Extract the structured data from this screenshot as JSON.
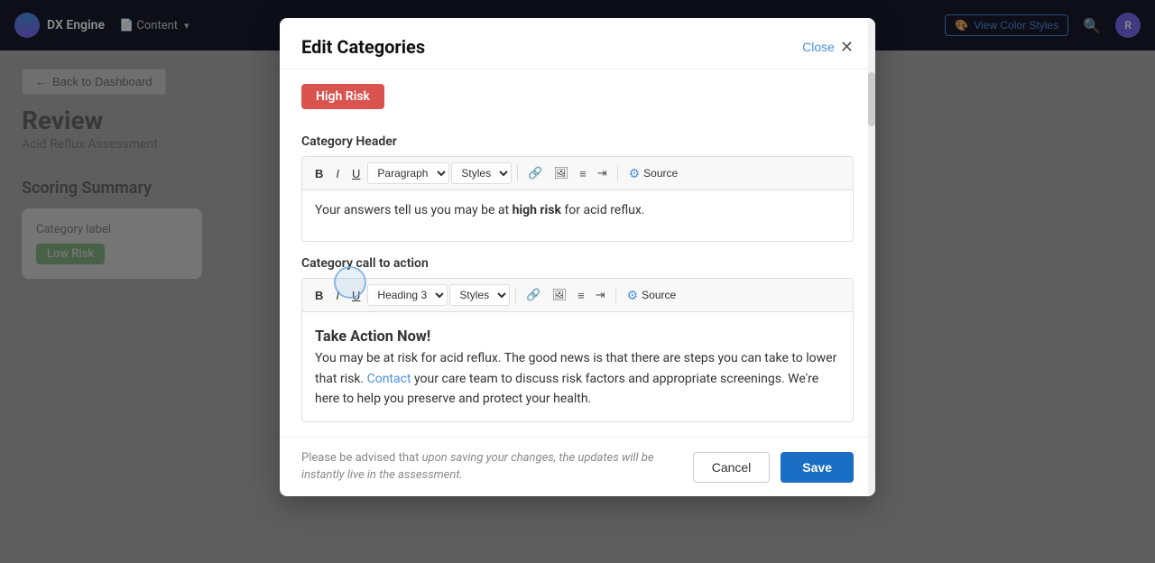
{
  "topnav": {
    "logo_text": "DX Engine",
    "nav_items": [
      "Content",
      ""
    ],
    "view_color_styles_label": "View Color Styles",
    "avatar_letter": "R"
  },
  "page": {
    "back_label": "Back to Dashboard",
    "title": "Review",
    "subtitle": "Acid Reflux Assessment",
    "scoring_heading": "Scoring Summary",
    "category_label": "Category label",
    "low_risk_badge": "Low Risk"
  },
  "modal": {
    "title": "Edit Categories",
    "close_label": "Close",
    "high_risk_badge": "High Risk",
    "category_header_label": "Category Header",
    "toolbar1": {
      "bold": "B",
      "italic": "I",
      "underline": "U",
      "paragraph_select": "Paragraph",
      "styles_select": "Styles",
      "source_label": "Source"
    },
    "header_content": "Your answers tell us you may be at",
    "header_bold": "high risk",
    "header_content_end": "for acid reflux.",
    "category_cta_label": "Category call to action",
    "toolbar2": {
      "bold": "B",
      "italic": "I",
      "underline": "U",
      "heading_select": "Heading 3",
      "styles_select": "Styles",
      "source_label": "Source"
    },
    "cta_heading": "Take Action Now!",
    "cta_para1_start": "You may be at risk for acid reflux. The good news is that there are steps you can take to lower that risk.",
    "cta_link": "Contact",
    "cta_para1_end": "your care team to discuss risk factors and appropriate screenings. We're here to help you preserve and protect your health.",
    "footer_note": "Please be advised that upon saving your changes, the updates will be instantly live in the assessment.",
    "cancel_label": "Cancel",
    "save_label": "Save"
  }
}
